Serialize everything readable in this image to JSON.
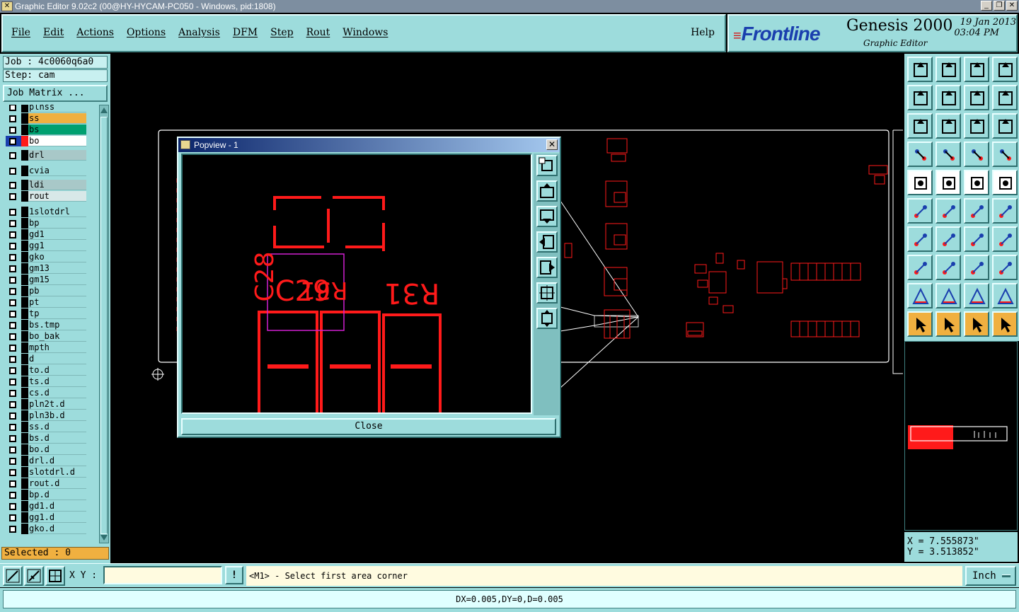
{
  "window": {
    "title": "Graphic Editor 9.02c2 (00@HY-HYCAM-PC050 - Windows, pid:1808)"
  },
  "menu": {
    "items": [
      "File",
      "Edit",
      "Actions",
      "Options",
      "Analysis",
      "DFM",
      "Step",
      "Rout",
      "Windows"
    ],
    "help": "Help"
  },
  "brand": {
    "logo": "Frontline",
    "product": "Genesis 2000",
    "subtitle": "Graphic Editor",
    "date": "19 Jan 2013",
    "time": "03:04 PM"
  },
  "job": {
    "job_line": "Job : 4c0060q6a0",
    "step_line": "Step: cam",
    "matrix_button": "Job Matrix ..."
  },
  "layers": [
    "plnss",
    "ss",
    "bs",
    "bo",
    "drl",
    "cvia",
    "ldi",
    "rout",
    "1slotdrl",
    "bp",
    "gd1",
    "gg1",
    "gko",
    "gm13",
    "gm15",
    "pb",
    "pt",
    "tp",
    "bs.tmp",
    "bo_bak",
    "mpth",
    "d",
    "to.d",
    "ts.d",
    "cs.d",
    "pln2t.d",
    "pln3b.d",
    "ss.d",
    "bs.d",
    "bo.d",
    "drl.d",
    "slotdrl.d",
    "rout.d",
    "bp.d",
    "gd1.d",
    "gg1.d",
    "gko.d"
  ],
  "selected": "Selected : 0",
  "popview": {
    "title": "Popview - 1",
    "close_label": "Close",
    "labels": [
      "C28",
      "C29",
      "R31",
      "R31"
    ]
  },
  "coords": {
    "x": "X = 7.555873\"",
    "y": "Y = 3.513852\""
  },
  "bottom": {
    "xy_label": "X Y :",
    "xy_value": "",
    "prompt": "<M1> - Select first area corner",
    "unit": "Inch"
  },
  "status": "DX=0.005,DY=0,D=0.005",
  "colors": {
    "panel": "#9ddcdc",
    "feature": "#ff1a1a",
    "selection": "#d020d0",
    "ss_layer": "#f0b040",
    "bs_layer": "#00a070"
  }
}
